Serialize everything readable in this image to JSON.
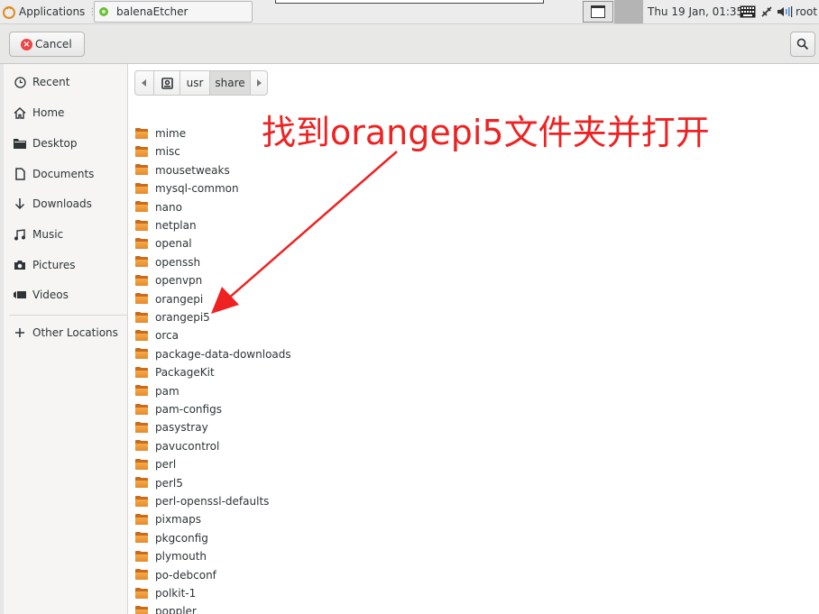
{
  "panel": {
    "applications_label": "Applications",
    "task_label": "balenaEtcher",
    "clock": "Thu 19 Jan, 01:35",
    "user": "root",
    "icons": [
      "applications-logo-icon",
      "balena-app-icon",
      "show-desktop-icon",
      "keyboard-icon",
      "network-icon",
      "volume-icon"
    ]
  },
  "header": {
    "cancel_label": "Cancel",
    "search_icon": "search-icon"
  },
  "sidebar": {
    "items": [
      {
        "label": "Recent",
        "icon": "clock-icon"
      },
      {
        "label": "Home",
        "icon": "home-icon"
      },
      {
        "label": "Desktop",
        "icon": "folder-icon"
      },
      {
        "label": "Documents",
        "icon": "document-icon"
      },
      {
        "label": "Downloads",
        "icon": "download-arrow-icon"
      },
      {
        "label": "Music",
        "icon": "music-note-icon"
      },
      {
        "label": "Pictures",
        "icon": "camera-icon"
      },
      {
        "label": "Videos",
        "icon": "video-icon"
      }
    ],
    "other_locations": "Other Locations"
  },
  "pathbar": {
    "segments": [
      "usr",
      "share"
    ],
    "active": "share"
  },
  "files": [
    "mime",
    "misc",
    "mousetweaks",
    "mysql-common",
    "nano",
    "netplan",
    "openal",
    "openssh",
    "openvpn",
    "orangepi",
    "orangepi5",
    "orca",
    "package-data-downloads",
    "PackageKit",
    "pam",
    "pam-configs",
    "pasystray",
    "pavucontrol",
    "perl",
    "perl5",
    "perl-openssl-defaults",
    "pixmaps",
    "pkgconfig",
    "plymouth",
    "po-debconf",
    "polkit-1",
    "poppler"
  ],
  "annotation": {
    "text": "找到orangepi5文件夹并打开",
    "color": "#ee2222"
  },
  "colors": {
    "folder": "#e48a2c",
    "annotation": "#ee2222",
    "panel_bg": "#ececec",
    "sidebar_bg": "#f6f5f4"
  }
}
